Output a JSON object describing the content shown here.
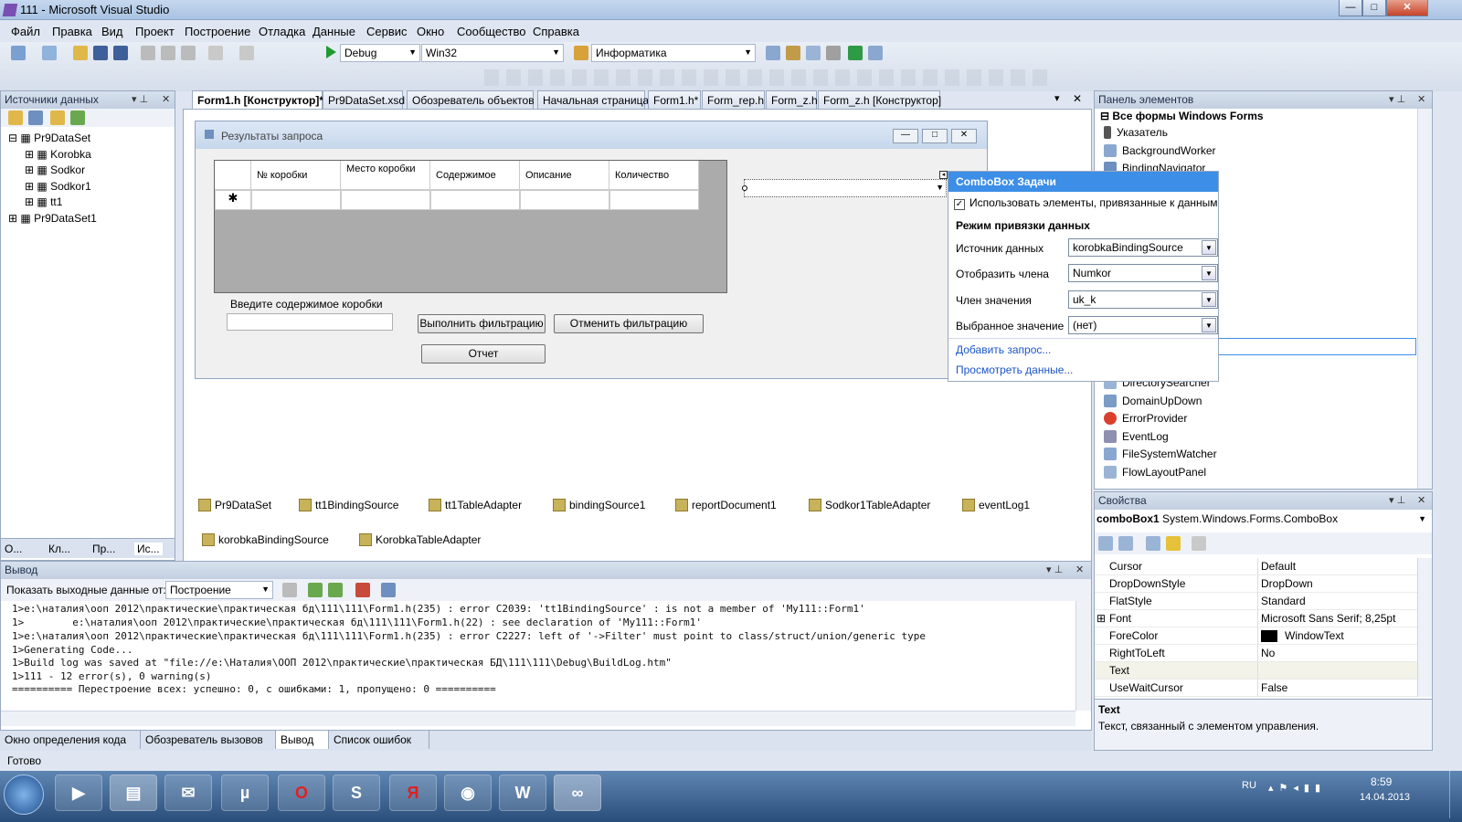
{
  "window": {
    "title": "111 - Microsoft Visual Studio",
    "min": "—",
    "max": "□",
    "close": "✕"
  },
  "menu": [
    "Файл",
    "Правка",
    "Вид",
    "Проект",
    "Построение",
    "Отладка",
    "Данные",
    "Сервис",
    "Окно",
    "Сообщество",
    "Справка"
  ],
  "toolbar": {
    "config": "Debug",
    "platform": "Win32",
    "solution": "Информатика"
  },
  "datasources": {
    "title": "Источники данных",
    "items": [
      "Pr9DataSet",
      "Korobka",
      "Sodkor",
      "Sodkor1",
      "tt1",
      "Pr9DataSet1"
    ],
    "bottom_tabs": [
      "О...",
      "Кл...",
      "Пр...",
      "Ис..."
    ]
  },
  "tabs": [
    "Form1.h [Конструктор]*",
    "Pr9DataSet.xsd",
    "Обозреватель объектов",
    "Начальная страница",
    "Form1.h*",
    "Form_rep.h",
    "Form_z.h",
    "Form_z.h [Конструктор]"
  ],
  "form": {
    "title": "Результаты запроса",
    "columns": [
      "№ коробки",
      "Место коробки",
      "Содержимое",
      "Описание",
      "Количество"
    ],
    "newrow": "✱",
    "label": "Введите содержимое коробки",
    "btn_filter": "Выполнить фильтрацию",
    "btn_cancel": "Отменить фильтрацию",
    "btn_report": "Отчет"
  },
  "smarttag": {
    "title": "ComboBox Задачи",
    "checkbox": "Использовать элементы, привязанные к данным",
    "section": "Режим привязки данных",
    "rows": [
      {
        "label": "Источник данных",
        "value": "korobkaBindingSource"
      },
      {
        "label": "Отобразить члена",
        "value": "Numkor"
      },
      {
        "label": "Член значения",
        "value": "uk_k"
      },
      {
        "label": "Выбранное значение",
        "value": "(нет)"
      }
    ],
    "link1": "Добавить запрос...",
    "link2": "Просмотреть данные..."
  },
  "components": [
    "Pr9DataSet",
    "tt1BindingSource",
    "tt1TableAdapter",
    "bindingSource1",
    "reportDocument1",
    "Sodkor1TableAdapter",
    "eventLog1",
    "korobkaBindingSource",
    "KorobkaTableAdapter"
  ],
  "output": {
    "title": "Вывод",
    "show_label": "Показать выходные данные от:",
    "show_value": "Построение",
    "lines": [
      "1>e:\\наталия\\ооп 2012\\практические\\практическая бд\\111\\111\\Form1.h(235) : error C2039: 'tt1BindingSource' : is not a member of 'My111::Form1'",
      "1>        e:\\наталия\\ооп 2012\\практические\\практическая бд\\111\\111\\Form1.h(22) : see declaration of 'My111::Form1'",
      "1>e:\\наталия\\ооп 2012\\практические\\практическая бд\\111\\111\\Form1.h(235) : error C2227: left of '->Filter' must point to class/struct/union/generic type",
      "1>Generating Code...",
      "1>Build log was saved at \"file://e:\\Наталия\\ООП 2012\\практические\\практическая БД\\111\\111\\Debug\\BuildLog.htm\"",
      "1>111 - 12 error(s), 0 warning(s)",
      "========== Перестроение всех: успешно: 0, с ошибками: 1, пропущено: 0 =========="
    ]
  },
  "bottom_tabs": [
    "Окно определения кода",
    "Обозреватель вызовов",
    "Вывод",
    "Список ошибок"
  ],
  "toolbox": {
    "title": "Панель элементов",
    "group": "Все формы Windows Forms",
    "items": [
      "Указатель",
      "BackgroundWorker",
      "BindingNavigator",
      "DirectorySearcher",
      "DomainUpDown",
      "ErrorProvider",
      "EventLog",
      "FileSystemWatcher",
      "FlowLayoutPanel"
    ]
  },
  "properties": {
    "title": "Свойства",
    "object": "comboBox1",
    "type": "System.Windows.Forms.ComboBox",
    "rows": [
      {
        "k": "Cursor",
        "v": "Default"
      },
      {
        "k": "DropDownStyle",
        "v": "DropDown"
      },
      {
        "k": "FlatStyle",
        "v": "Standard"
      },
      {
        "k": "Font",
        "v": "Microsoft Sans Serif; 8,25pt"
      },
      {
        "k": "ForeColor",
        "v": "WindowText"
      },
      {
        "k": "RightToLeft",
        "v": "No"
      },
      {
        "k": "Text",
        "v": ""
      },
      {
        "k": "UseWaitCursor",
        "v": "False"
      }
    ],
    "desc_title": "Text",
    "desc": "Текст, связанный с элементом управления."
  },
  "status": "Готово",
  "taskbar": {
    "lang": "RU",
    "time": "8:59",
    "date": "14.04.2013"
  }
}
